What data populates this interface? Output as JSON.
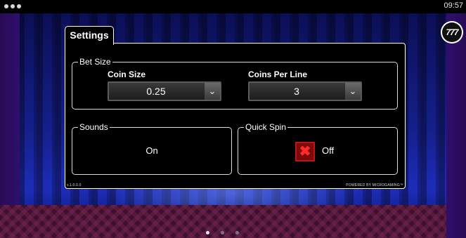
{
  "statusbar": {
    "time": "09:57"
  },
  "logo": {
    "text": "777"
  },
  "settings": {
    "tab_label": "Settings",
    "bet_size": {
      "legend": "Bet Size",
      "coin_size": {
        "label": "Coin Size",
        "value": "0.25"
      },
      "coins_per_line": {
        "label": "Coins Per Line",
        "value": "3"
      }
    },
    "sounds": {
      "legend": "Sounds",
      "state": "On"
    },
    "quick_spin": {
      "legend": "Quick Spin",
      "state": "Off"
    },
    "version": "v.1.0.0.0",
    "powered_by": "POWERED BY MICROGAMING™"
  },
  "pagination": {
    "count": 3,
    "active": 0
  }
}
